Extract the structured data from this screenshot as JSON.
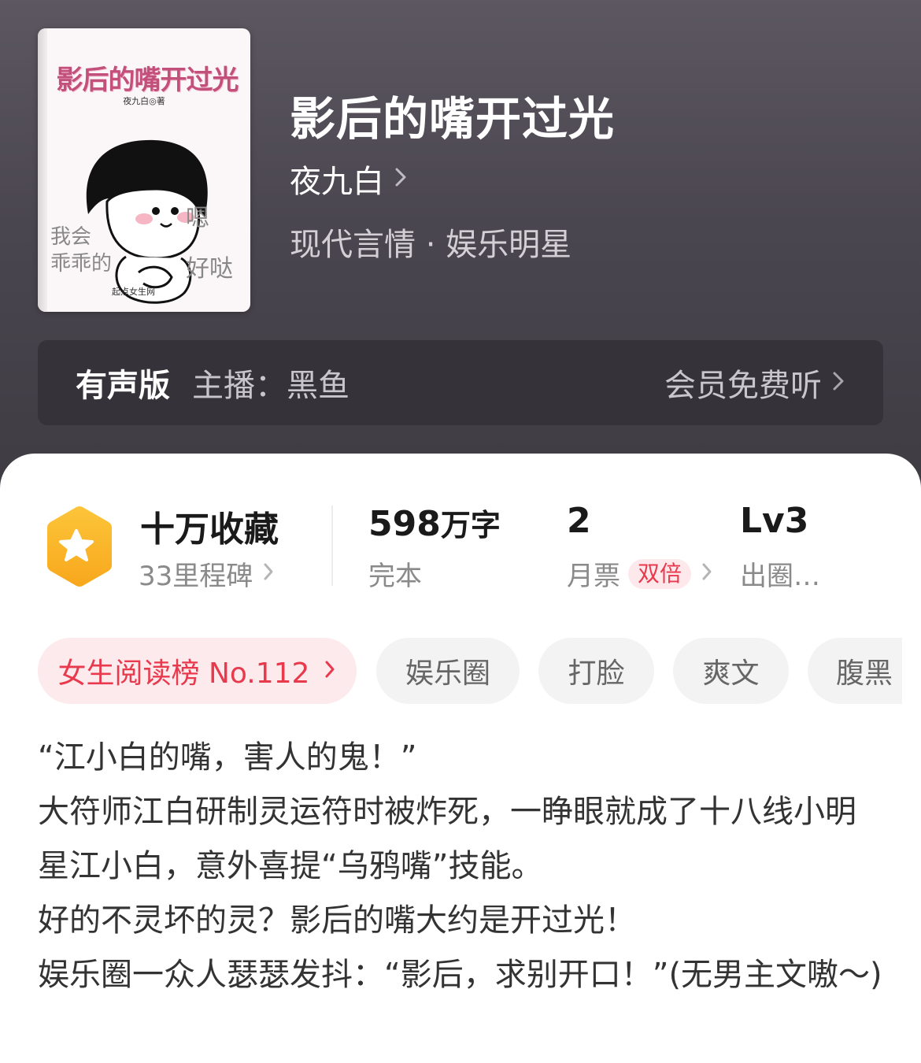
{
  "book": {
    "title": "影后的嘴开过光",
    "author": "夜九白",
    "genre": "现代言情 · 娱乐明星"
  },
  "cover": {
    "title": "影后的嘴开过光",
    "author_line": "夜九白◎著",
    "handwriting_left": "我会\n乖乖的",
    "handwriting_right": "嗯\n好哒",
    "logo": "起点女生网"
  },
  "audio": {
    "label": "有声版",
    "host": "主播：黑鱼",
    "action": "会员免费听"
  },
  "stats": {
    "collect": {
      "main": "十万收藏",
      "sub": "33里程碑"
    },
    "words": {
      "number": "598",
      "unit": "万字",
      "sub": "完本"
    },
    "tickets": {
      "main": "2",
      "sub": "月票",
      "badge": "双倍"
    },
    "level": {
      "main": "Lv3",
      "sub": "出圈…"
    }
  },
  "tags": [
    "女生阅读榜 No.112",
    "娱乐圈",
    "打脸",
    "爽文",
    "腹黑"
  ],
  "description": [
    "“江小白的嘴，害人的鬼！”",
    "大符师江白研制灵运符时被炸死，一睁眼就成了十八线小明星江小白，意外喜提“乌鸦嘴”技能。",
    "好的不灵坏的灵？影后的嘴大约是开过光！",
    "娱乐圈一众人瑟瑟发抖：“影后，求别开口！”(无男主文嗷～)"
  ],
  "colors": {
    "header_bg": "#4a4650",
    "accent_red": "#e8394d",
    "badge_orange": "#fbb62c"
  }
}
